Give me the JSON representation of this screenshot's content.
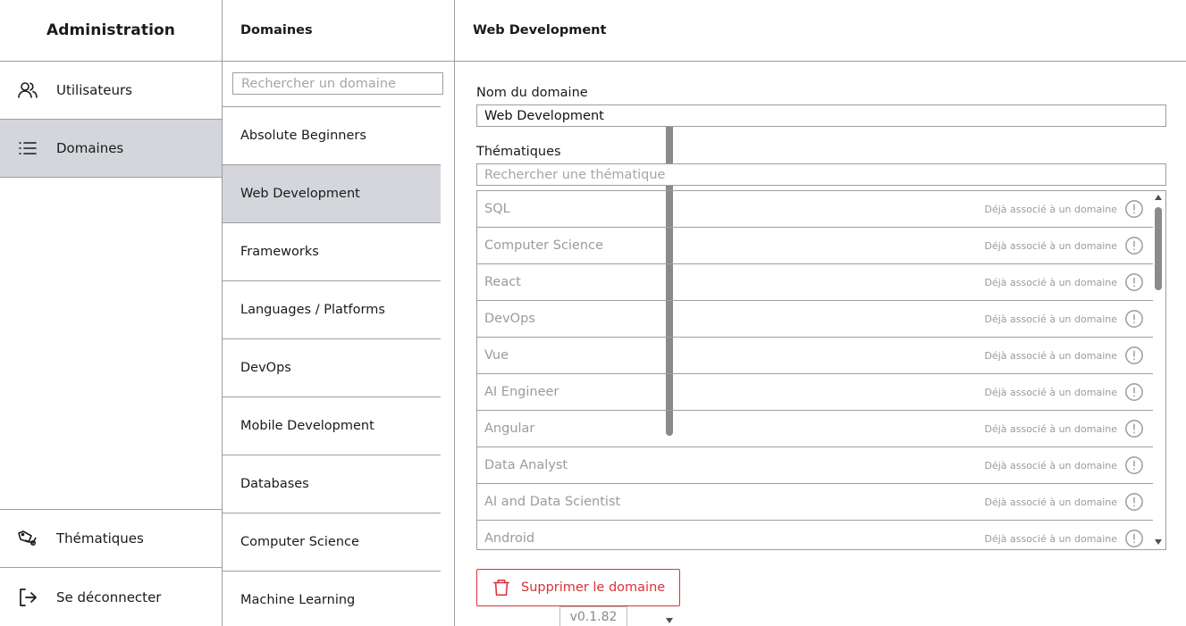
{
  "sidebar": {
    "title": "Administration",
    "items": [
      {
        "label": "Utilisateurs",
        "icon": "users-icon"
      },
      {
        "label": "Domaines",
        "icon": "list-icon",
        "active": true
      }
    ],
    "bottom_items": [
      {
        "label": "Thématiques",
        "icon": "tags-icon"
      },
      {
        "label": "Se déconnecter",
        "icon": "logout-icon"
      }
    ]
  },
  "domains": {
    "header": "Domaines",
    "search_placeholder": "Rechercher un domaine",
    "items": [
      "Absolute Beginners",
      "Web Development",
      "Frameworks",
      "Languages / Platforms",
      "DevOps",
      "Mobile Development",
      "Databases",
      "Computer Science",
      "Machine Learning"
    ],
    "selected": "Web Development"
  },
  "detail": {
    "header": "Web Development",
    "name_label": "Nom du domaine",
    "name_value": "Web Development",
    "themes_label": "Thématiques",
    "themes_search_placeholder": "Rechercher une thématique",
    "themes": [
      {
        "name": "SQL",
        "note": "Déjà associé à un domaine"
      },
      {
        "name": "Computer Science",
        "note": "Déjà associé à un domaine"
      },
      {
        "name": "React",
        "note": "Déjà associé à un domaine"
      },
      {
        "name": "DevOps",
        "note": "Déjà associé à un domaine"
      },
      {
        "name": "Vue",
        "note": "Déjà associé à un domaine"
      },
      {
        "name": "AI Engineer",
        "note": "Déjà associé à un domaine"
      },
      {
        "name": "Angular",
        "note": "Déjà associé à un domaine"
      },
      {
        "name": "Data Analyst",
        "note": "Déjà associé à un domaine"
      },
      {
        "name": "AI and Data Scientist",
        "note": "Déjà associé à un domaine"
      },
      {
        "name": "Android",
        "note": "Déjà associé à un domaine"
      }
    ],
    "delete_label": "Supprimer le domaine"
  },
  "version": "v0.1.82",
  "colors": {
    "active_bg": "#d4d6db",
    "border": "#9e9e9e",
    "danger": "#d9313a",
    "muted_text": "#9b9b9b"
  }
}
